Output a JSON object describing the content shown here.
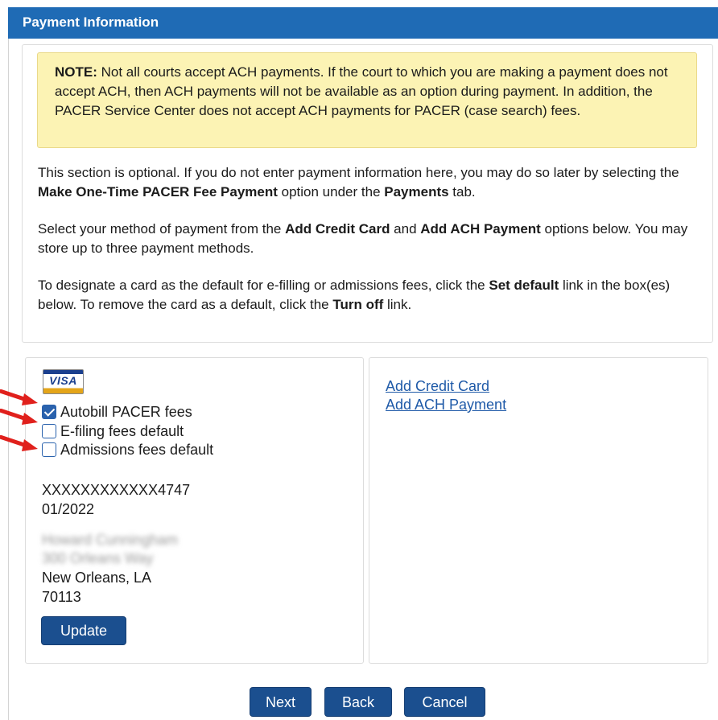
{
  "header": {
    "title": "Payment Information"
  },
  "note": {
    "bold": "NOTE:",
    "text": " Not all courts accept ACH payments. If the court to which you are making a payment does not accept ACH, then ACH payments will not be available as an option during payment. In addition, the PACER Service Center does not accept ACH payments for PACER (case search) fees."
  },
  "paragraphs": {
    "p1": {
      "a": "This section is optional. If you do not enter payment information here, you may do so later by selecting the ",
      "b": "Make One-Time PACER Fee Payment",
      "c": " option under the ",
      "d": "Payments",
      "e": " tab."
    },
    "p2": {
      "a": "Select your method of payment from the ",
      "b": "Add Credit Card",
      "c": " and ",
      "d": "Add ACH Payment",
      "e": " options below. You may store up to three payment methods."
    },
    "p3": {
      "a": "To designate a card as the default for e-filling or admissions fees, click the ",
      "b": "Set default",
      "c": " link in the box(es) below. To remove the card as a default, click the ",
      "d": "Turn off",
      "e": " link."
    }
  },
  "card": {
    "brand_label": "VISA",
    "options": [
      {
        "label": "Autobill PACER fees",
        "checked": true
      },
      {
        "label": "E-filing fees default",
        "checked": false
      },
      {
        "label": "Admissions fees default",
        "checked": false
      }
    ],
    "number": "XXXXXXXXXXXX4747",
    "expiry": "01/2022",
    "name_redacted": "Howard Cunningham",
    "street_redacted": "300 Orleans Way",
    "city_state": "New Orleans, LA",
    "zip": "70113",
    "update_label": "Update"
  },
  "actions": {
    "add_credit_card": "Add Credit Card",
    "add_ach_payment": "Add ACH Payment"
  },
  "footer": {
    "next_label": "Next",
    "back_label": "Back",
    "cancel_label": "Cancel"
  },
  "colors": {
    "header_bg": "#1f6bb5",
    "note_bg": "#fcf3b4",
    "button_bg": "#1b4f8f",
    "link": "#1f5aa8",
    "checkbox": "#2a62ad",
    "annotation_arrow": "#e0201c"
  }
}
